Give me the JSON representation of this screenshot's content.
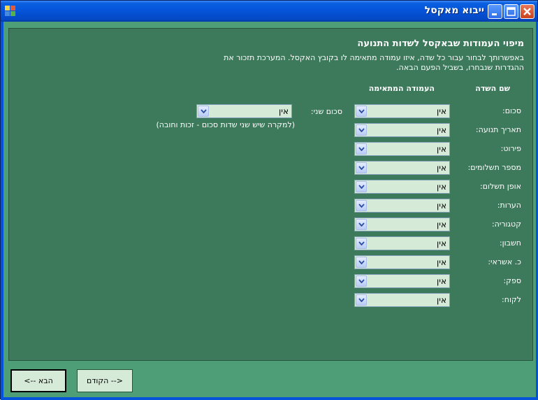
{
  "window": {
    "title": "ייבוא מאקסל"
  },
  "titlebar_buttons": {
    "minimize_icon": "minimize-icon",
    "maximize_icon": "maximize-icon",
    "close_icon": "close-icon"
  },
  "panel": {
    "heading": "מיפוי העמודות שבאקסל לשדות התנועה",
    "description": "באפשרותך לבחור עבור כל שדה, איזו עמודה מתאימה לו בקובץ האקסל. המערכת תזכור את ההגדרות שנבחרו, בשביל הפעם הבאה.",
    "col_field_name": "שם השדה",
    "col_matching_column": "העמודה המתאימה"
  },
  "fields": [
    {
      "label": "סכום:",
      "value": "אין"
    },
    {
      "label": "תאריך תנועה:",
      "value": "אין"
    },
    {
      "label": "פירוט:",
      "value": "אין"
    },
    {
      "label": "מספר תשלומים:",
      "value": "אין"
    },
    {
      "label": "אופן תשלום:",
      "value": "אין"
    },
    {
      "label": "הערות:",
      "value": "אין"
    },
    {
      "label": "קטגוריה:",
      "value": "אין"
    },
    {
      "label": "חשבון:",
      "value": "אין"
    },
    {
      "label": "כ. אשראי:",
      "value": "אין"
    },
    {
      "label": "ספק:",
      "value": "אין"
    },
    {
      "label": "לקוח:",
      "value": "אין"
    }
  ],
  "second_amount": {
    "label": "סכום שני:",
    "value": "אין",
    "note": "(למקרה שיש שני שדות סכום - זכות וחובה)"
  },
  "buttons": {
    "next": "הבא -->",
    "back": "<-- הקודם"
  }
}
